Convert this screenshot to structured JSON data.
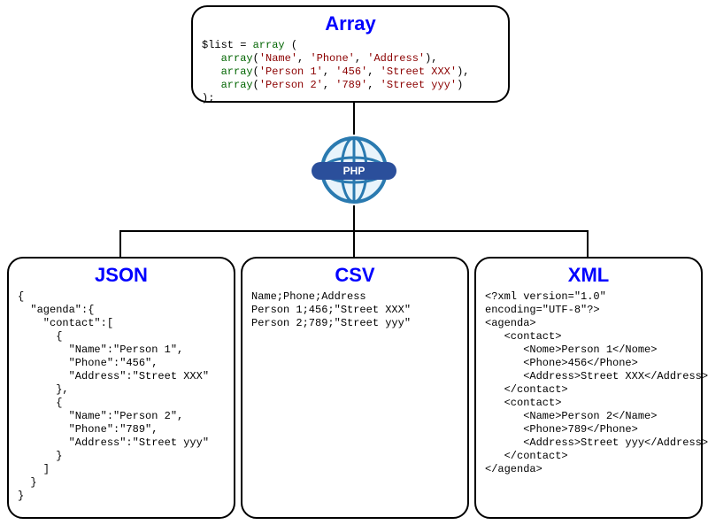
{
  "topBox": {
    "title": "Array",
    "code": {
      "assign": "$list = ",
      "arrayKw": "array",
      "open": " (",
      "rows": [
        [
          "'Name'",
          "'Phone'",
          "'Address'"
        ],
        [
          "'Person 1'",
          "'456'",
          "'Street XXX'"
        ],
        [
          "'Person 2'",
          "'789'",
          "'Street yyy'"
        ]
      ],
      "close": ");"
    }
  },
  "phpLabel": "PHP",
  "bottom": {
    "json": {
      "title": "JSON",
      "code": "{\n  \"agenda\":{\n    \"contact\":[\n      {\n        \"Name\":\"Person 1\",\n        \"Phone\":\"456\",\n        \"Address\":\"Street XXX\"\n      },\n      {\n        \"Name\":\"Person 2\",\n        \"Phone\":\"789\",\n        \"Address\":\"Street yyy\"\n      }\n    ]\n  }\n}"
    },
    "csv": {
      "title": "CSV",
      "code": "Name;Phone;Address\nPerson 1;456;\"Street XXX\"\nPerson 2;789;\"Street yyy\""
    },
    "xml": {
      "title": "XML",
      "code": "<?xml version=\"1.0\"\nencoding=\"UTF-8\"?>\n<agenda>\n   <contact>\n      <Nome>Person 1</Nome>\n      <Phone>456</Phone>\n      <Address>Street XXX</Address>\n   </contact>\n   <contact>\n      <Name>Person 2</Name>\n      <Phone>789</Phone>\n      <Address>Street yyy</Address>\n   </contact>\n</agenda>"
    }
  }
}
